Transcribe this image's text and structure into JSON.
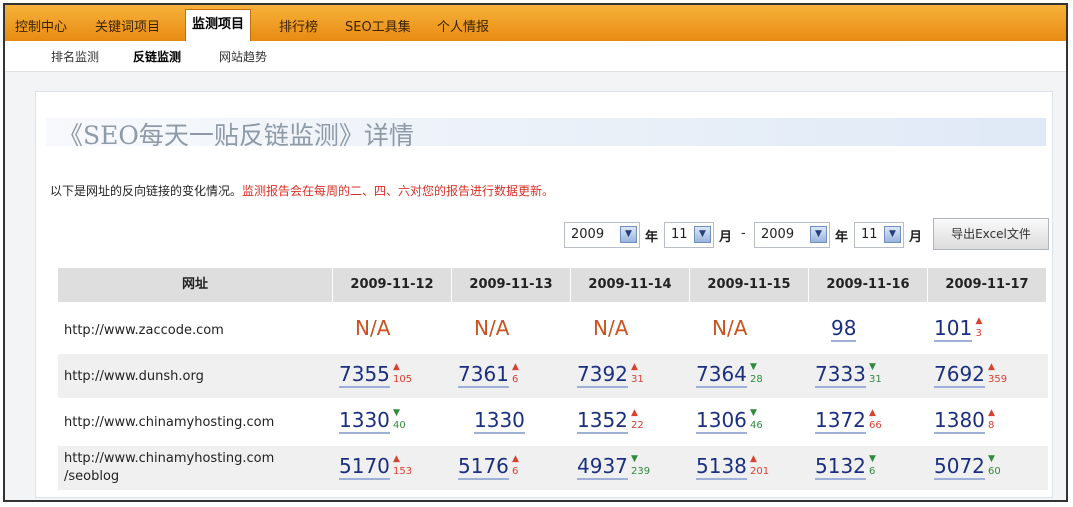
{
  "nav": {
    "items": [
      "控制中心",
      "关键词项目",
      "监测项目",
      "排行榜",
      "SEO工具集",
      "个人情报"
    ],
    "active": 2
  },
  "subnav": {
    "items": [
      "排名监测",
      "反链监测",
      "网站趋势"
    ],
    "active": 1
  },
  "page": {
    "title": "《SEO每天一贴反链监测》详情",
    "info": "以下是网址的反向链接的变化情况。",
    "info_notice": "监测报告会在每周的二、四、六对您的报告进行数据更新。"
  },
  "filters": {
    "from_year": "2009",
    "from_month": "11",
    "to_year": "2009",
    "to_month": "11",
    "year_label": "年",
    "month_label": "月",
    "separator": "-",
    "export_label": "导出Excel文件",
    "arrow_icon": "chevron-down-icon"
  },
  "table": {
    "url_header": "网址",
    "dates": [
      "2009-11-12",
      "2009-11-13",
      "2009-11-14",
      "2009-11-15",
      "2009-11-16",
      "2009-11-17"
    ],
    "rows": [
      {
        "url_lines": [
          "http://www.zaccode.com"
        ],
        "cells": [
          {
            "value": "N/A",
            "na": true
          },
          {
            "value": "N/A",
            "na": true
          },
          {
            "value": "N/A",
            "na": true
          },
          {
            "value": "N/A",
            "na": true
          },
          {
            "value": "98"
          },
          {
            "value": "101",
            "dir": "up",
            "delta": "3"
          }
        ]
      },
      {
        "url_lines": [
          "http://www.dunsh.org"
        ],
        "cells": [
          {
            "value": "7355",
            "dir": "up",
            "delta": "105"
          },
          {
            "value": "7361",
            "dir": "up",
            "delta": "6"
          },
          {
            "value": "7392",
            "dir": "up",
            "delta": "31"
          },
          {
            "value": "7364",
            "dir": "down",
            "delta": "28"
          },
          {
            "value": "7333",
            "dir": "down",
            "delta": "31"
          },
          {
            "value": "7692",
            "dir": "up",
            "delta": "359"
          }
        ]
      },
      {
        "url_lines": [
          "http://www.chinamyhosting.com"
        ],
        "cells": [
          {
            "value": "1330",
            "dir": "down",
            "delta": "40"
          },
          {
            "value": "1330"
          },
          {
            "value": "1352",
            "dir": "up",
            "delta": "22"
          },
          {
            "value": "1306",
            "dir": "down",
            "delta": "46"
          },
          {
            "value": "1372",
            "dir": "up",
            "delta": "66"
          },
          {
            "value": "1380",
            "dir": "up",
            "delta": "8"
          }
        ]
      },
      {
        "url_lines": [
          "http://www.chinamyhosting.com",
          "/seoblog"
        ],
        "cells": [
          {
            "value": "5170",
            "dir": "up",
            "delta": "153"
          },
          {
            "value": "5176",
            "dir": "up",
            "delta": "6"
          },
          {
            "value": "4937",
            "dir": "down",
            "delta": "239"
          },
          {
            "value": "5138",
            "dir": "up",
            "delta": "201"
          },
          {
            "value": "5132",
            "dir": "down",
            "delta": "6"
          },
          {
            "value": "5072",
            "dir": "down",
            "delta": "60"
          }
        ]
      }
    ]
  },
  "colors": {
    "nav_orange": "#f0a02a",
    "value_blue": "#1a2f80",
    "na_orange": "#c8531f",
    "up_red": "#d94030",
    "down_green": "#2e8b3c",
    "notice_red": "#d93025"
  }
}
